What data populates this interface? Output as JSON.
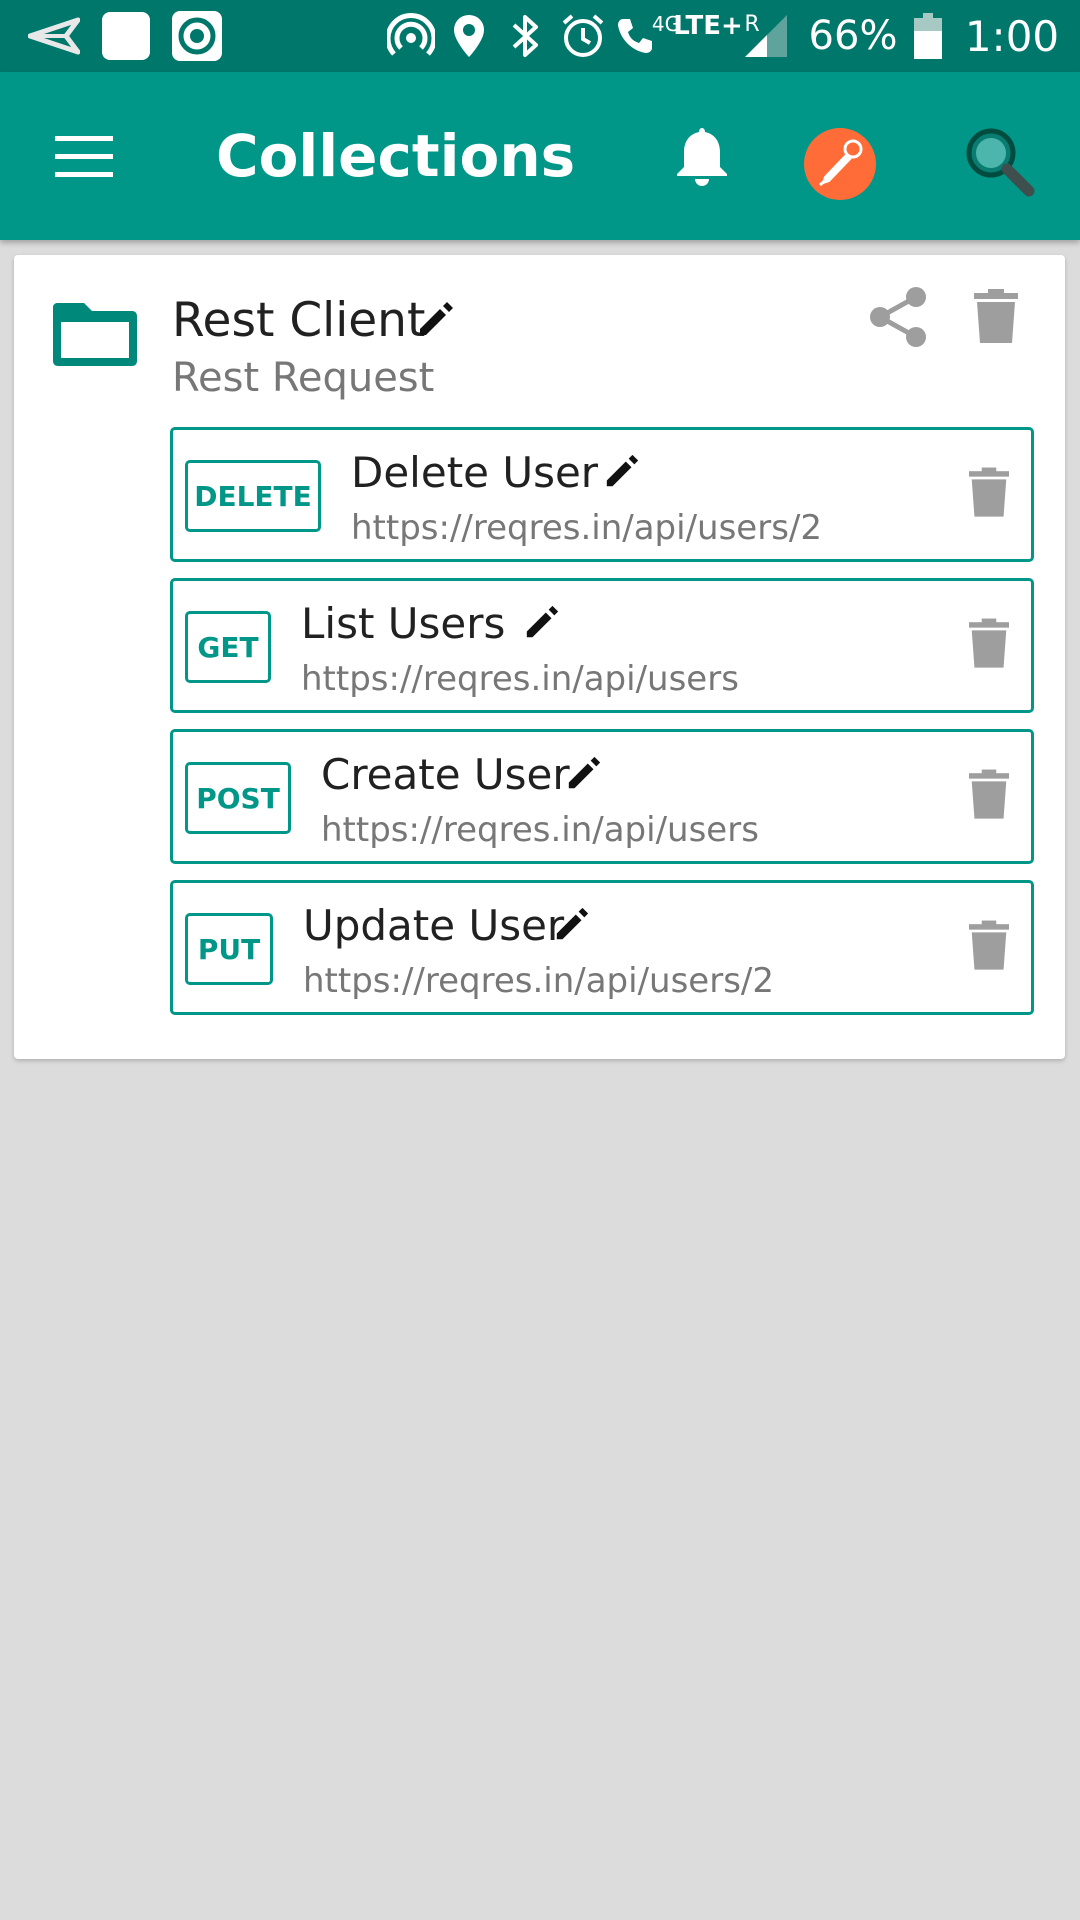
{
  "status_bar": {
    "network": "4G",
    "carrier": "LTE+",
    "roaming": "R",
    "battery": "66%",
    "time": "1:00",
    "icons": [
      "send-icon",
      "square-app-icon",
      "target-app-icon",
      "hotspot-icon",
      "location-icon",
      "bluetooth-icon",
      "alarm-icon",
      "call-volte-icon",
      "signal-icon",
      "battery-icon"
    ]
  },
  "app_bar": {
    "title": "Collections",
    "icons": [
      "menu-icon",
      "bell-icon",
      "postman-logo-icon",
      "search-icon"
    ]
  },
  "collection": {
    "name": "Rest Client",
    "description": "Rest Request",
    "requests": [
      {
        "method": "DELETE",
        "name": "Delete User",
        "url": "https://reqres.in/api/users/2"
      },
      {
        "method": "GET",
        "name": "List Users",
        "url": "https://reqres.in/api/users"
      },
      {
        "method": "POST",
        "name": "Create User",
        "url": "https://reqres.in/api/users"
      },
      {
        "method": "PUT",
        "name": "Update User",
        "url": "https://reqres.in/api/users/2"
      }
    ]
  },
  "colors": {
    "status_bar": "#00776b",
    "app_bar": "#009688",
    "accent": "#009688",
    "postman_orange": "#ff6c37",
    "background": "#dcdcdc",
    "card": "#ffffff",
    "icon_grey": "#9e9e9e"
  }
}
